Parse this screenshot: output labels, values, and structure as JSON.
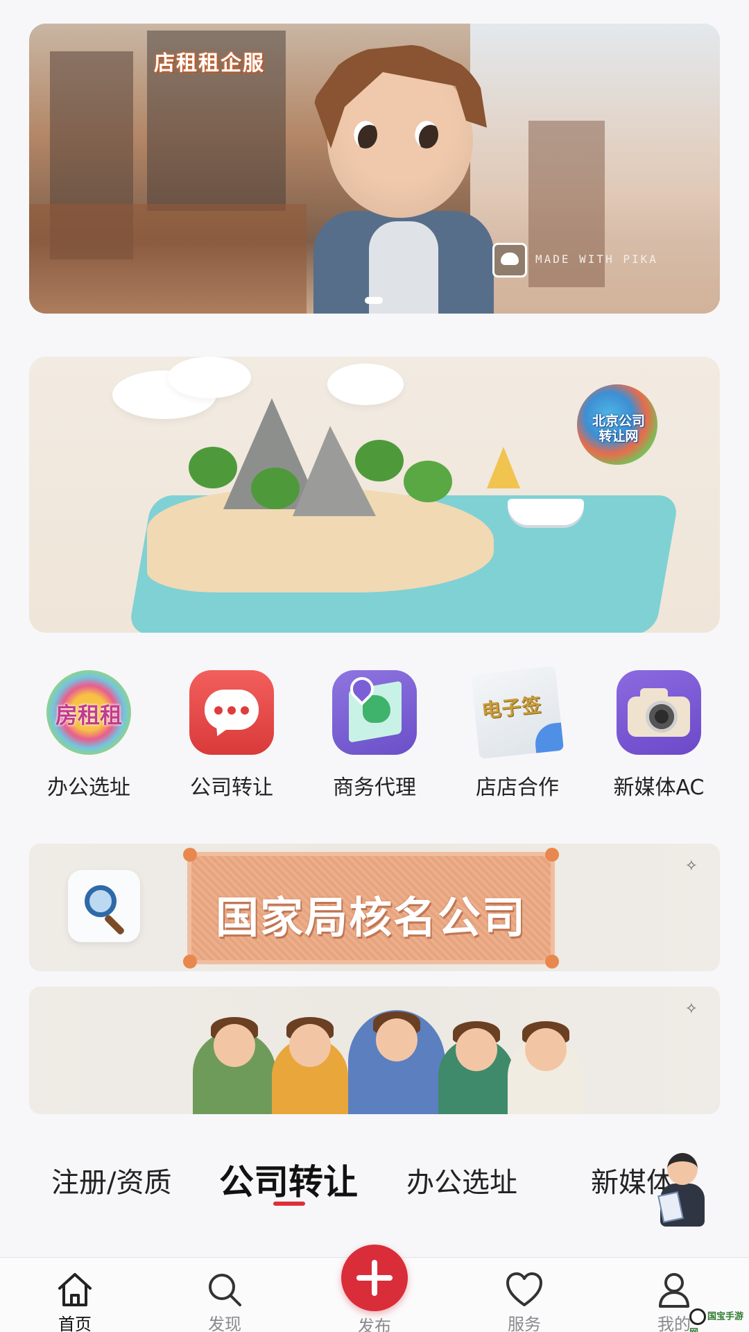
{
  "banners": {
    "hero": {
      "brand_text": "店租租企服",
      "watermark_text": "MADE WITH PIKA"
    },
    "secondary": {
      "badge_text_line1": "北京公司",
      "badge_text_line2": "转让网"
    }
  },
  "quick_links": [
    {
      "label": "办公选址",
      "icon_text": "房租租",
      "icon": "colorful-house-badge-icon"
    },
    {
      "label": "公司转让",
      "icon": "chat-bubble-icon"
    },
    {
      "label": "商务代理",
      "icon": "map-pin-icon"
    },
    {
      "label": "店店合作",
      "icon_text": "电子签",
      "icon": "e-sign-document-icon"
    },
    {
      "label": "新媒体AC",
      "icon": "camera-icon"
    }
  ],
  "promos": {
    "name_check": {
      "title": "国家局核名公司"
    },
    "group": {}
  },
  "tabs": [
    {
      "label": "注册/资质"
    },
    {
      "label": "公司转让",
      "active": true
    },
    {
      "label": "办公选址"
    },
    {
      "label": "新媒体"
    }
  ],
  "bottom_nav": [
    {
      "label": "首页",
      "icon": "home-icon",
      "active": true
    },
    {
      "label": "发现",
      "icon": "search-icon"
    },
    {
      "label": "发布",
      "icon": "plus-icon"
    },
    {
      "label": "服务",
      "icon": "heart-icon"
    },
    {
      "label": "我的",
      "icon": "user-icon"
    }
  ],
  "corner_logo": {
    "text": "国宝手游网"
  },
  "colors": {
    "accent": "#d92d3a",
    "tab_underline": "#e02e3a"
  }
}
